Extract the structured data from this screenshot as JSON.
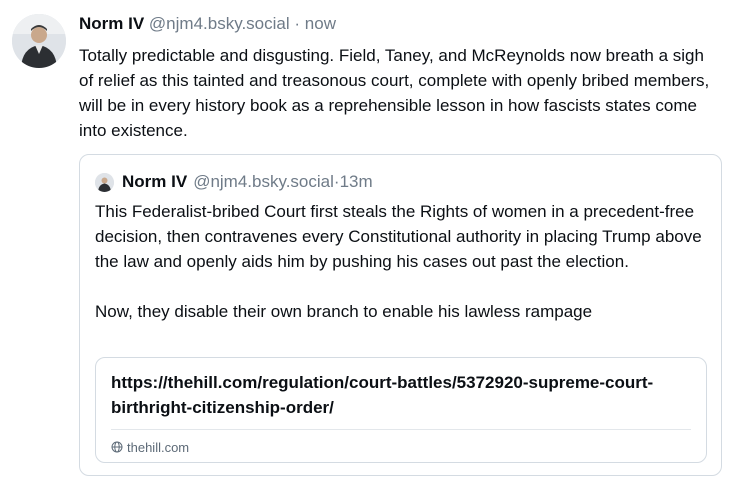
{
  "post": {
    "author_name": "Norm IV",
    "handle": "@njm4.bsky.social",
    "separator": "·",
    "time": "now",
    "text": "Totally predictable and disgusting. Field, Taney, and McReynolds now breath a sigh of relief as this tainted and treasonous court, complete with openly bribed members, will be in every history book as a reprehensible lesson in how fascists states come into existence."
  },
  "quoted_post": {
    "author_name": "Norm IV",
    "handle": "@njm4.bsky.social",
    "separator": "·",
    "time": "13m",
    "paragraph_1": "This Federalist-bribed Court first steals the Rights of women in a precedent-free decision, then contravenes every Constitutional authority in placing Trump above the law and openly aids him by pushing his cases out past the election.",
    "paragraph_2": "Now, they disable their own branch to enable his lawless rampage",
    "link_card": {
      "title": "https://thehill.com/regulation/court-battles/5372920-supreme-court-birthright-citizenship-order/",
      "domain": "thehill.com",
      "icon": "globe-icon"
    }
  },
  "colors": {
    "text": "#0b0f14",
    "muted": "#6f7b88",
    "border": "#d4dbe2"
  }
}
